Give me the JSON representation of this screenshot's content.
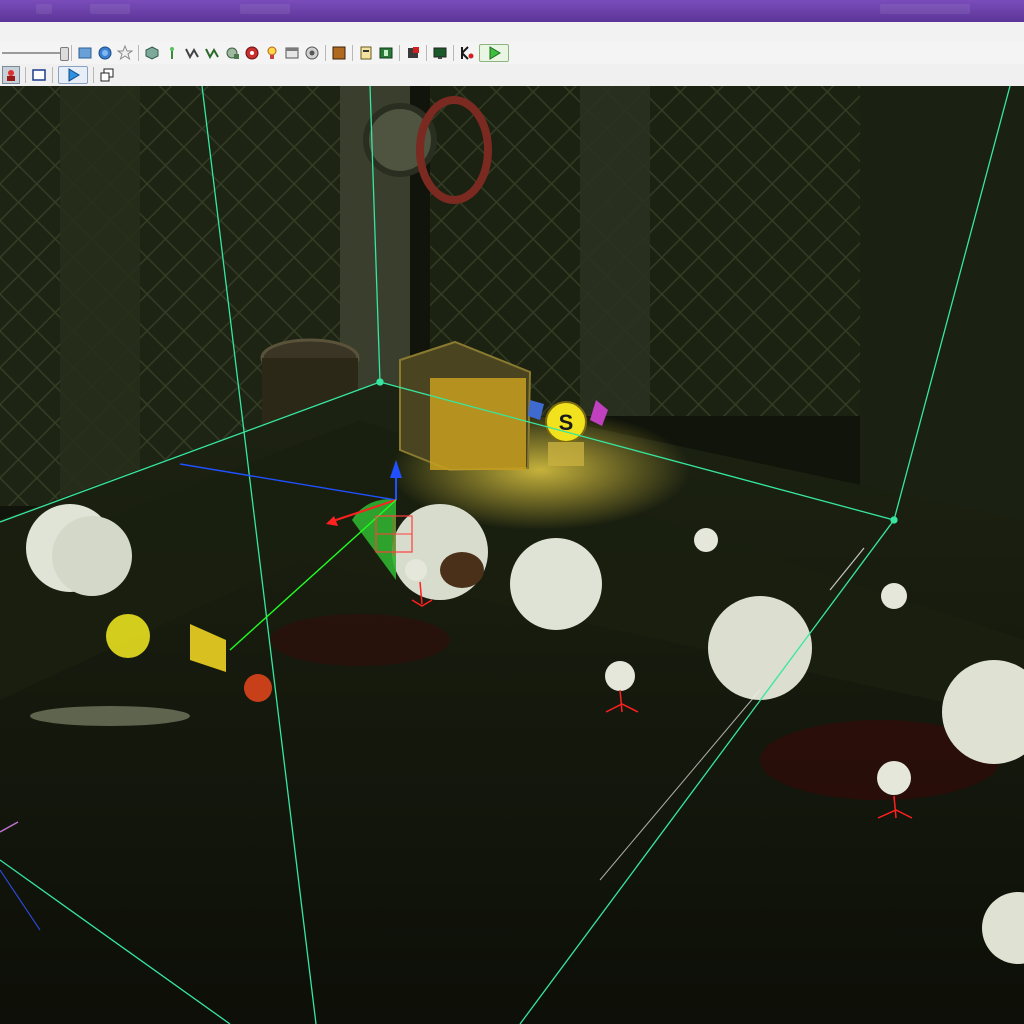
{
  "window": {
    "title_color": "#6a41a8"
  },
  "toolbar_row_1": {
    "zoom_slider": {
      "value_fraction": 0.9
    },
    "icons": [
      "folder-view-icon",
      "globe-icon",
      "star-icon",
      "mesh-icon",
      "pin-icon",
      "path-icon",
      "path-alt-icon",
      "camera-icon",
      "gear-red-icon",
      "lightbulb-icon",
      "window-icon",
      "sound-icon",
      "texture-icon",
      "script-icon",
      "film-icon",
      "export-icon",
      "monitor-icon",
      "kismet-icon",
      "play-icon"
    ]
  },
  "toolbar_row_2": {
    "icons": [
      "actor-red-icon",
      "viewport-frame-icon",
      "play-blue-icon",
      "maximize-icon"
    ]
  },
  "scene": {
    "pickup_letter": "S",
    "selection_box_color": "#37e6a0",
    "gizmo_colors": {
      "x": "#ff2020",
      "y": "#20ff20",
      "z": "#2050ff"
    }
  }
}
